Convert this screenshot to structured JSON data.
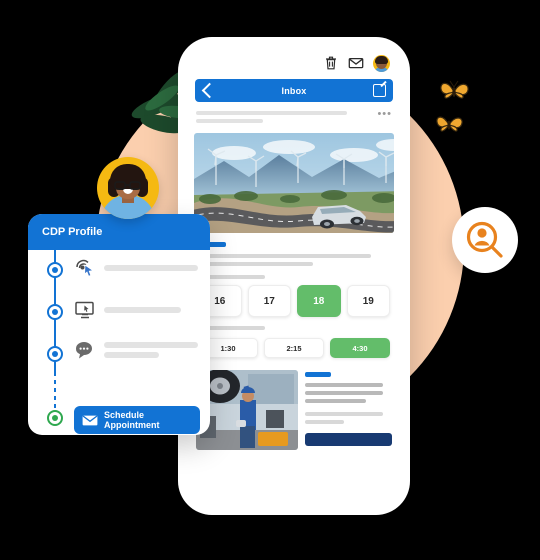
{
  "phone": {
    "topbar_icons": [
      "trash-icon",
      "envelope-icon",
      "avatar-icon"
    ],
    "nav": {
      "back_icon": "chevron-left-icon",
      "title": "Inbox",
      "compose_icon": "compose-icon"
    },
    "message_preview": {
      "overflow_menu": "•••"
    },
    "hero_image_alt": "silver car driving on winding mountain road with wind turbines",
    "appointment": {
      "dates": [
        {
          "label": "16",
          "selected": false
        },
        {
          "label": "17",
          "selected": false
        },
        {
          "label": "18",
          "selected": true
        },
        {
          "label": "19",
          "selected": false
        }
      ],
      "times": [
        {
          "label": "1:30",
          "selected": false
        },
        {
          "label": "2:15",
          "selected": false
        },
        {
          "label": "4:30",
          "selected": true
        }
      ]
    },
    "service_section": {
      "image_alt": "mechanic in blue uniform servicing a lifted vehicle",
      "cta_label": ""
    }
  },
  "cdp_card": {
    "title": "CDP Profile",
    "timeline": [
      {
        "icon": "click-target-icon",
        "state": "blue"
      },
      {
        "icon": "monitor-cursor-icon",
        "state": "blue"
      },
      {
        "icon": "chat-bubble-icon",
        "state": "blue"
      },
      {
        "icon": "envelope-icon",
        "state": "green"
      }
    ],
    "cta": {
      "label": "Schedule Appointment",
      "icon": "envelope-icon"
    }
  },
  "badges": {
    "person_search_icon": "person-search-icon",
    "profile_avatar_alt": "smiling woman with glasses and curly hair"
  },
  "decor": {
    "plant_alt": "green monstera leaves",
    "butterflies": 2,
    "circle_alt": "peach background circle"
  },
  "colors": {
    "blue": "#1273d4",
    "navy": "#183a72",
    "green": "#63bd6a",
    "green_dark": "#2fa84f",
    "peach": "#fbcfae",
    "yellow": "#f5b912",
    "orange": "#e8821e",
    "gray_line": "#e2e2e2"
  }
}
